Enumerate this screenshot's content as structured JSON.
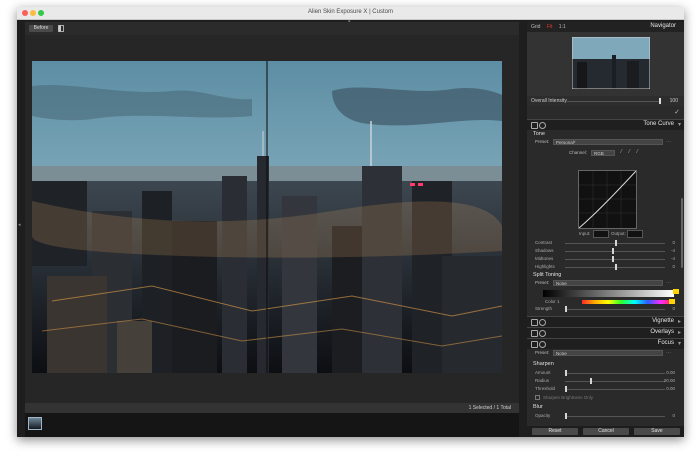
{
  "window": {
    "title": "Alien Skin Exposure X | Custom"
  },
  "viewer": {
    "before_label": "Before",
    "info_bar": "1 Selected / 1 Total"
  },
  "navigator": {
    "tabs": [
      "Grid",
      "Fit",
      "1:1"
    ],
    "title": "Navigator",
    "overall_intensity_label": "Overall Intensity",
    "overall_intensity_value": "100"
  },
  "tone_curve": {
    "title": "Tone Curve",
    "tone_label": "Tone",
    "preset_label": "Preset:",
    "preset_value": "Personal*",
    "channel_label": "Channel:",
    "channel_value": "RGB",
    "input_label": "Input:",
    "output_label": "Output:",
    "sliders": [
      {
        "label": "Contrast",
        "value": "0",
        "pos": 0.5
      },
      {
        "label": "Shadows",
        "value": "-4",
        "pos": 0.47
      },
      {
        "label": "Midtones",
        "value": "-4",
        "pos": 0.47
      },
      {
        "label": "Highlights",
        "value": "0",
        "pos": 0.5
      }
    ]
  },
  "split_toning": {
    "title": "Split Toning",
    "preset_label": "Preset:",
    "preset_value": "None",
    "color1_label": "Color 1",
    "strength_label": "Strength",
    "strength_value": "0",
    "color1_swatch": "#ffd400"
  },
  "vignette": {
    "title": "Vignette"
  },
  "overlays": {
    "title": "Overlays"
  },
  "focus": {
    "title": "Focus",
    "preset_label": "Preset:",
    "preset_value": "None",
    "sharpen_label": "Sharpen",
    "sharpen_sliders": [
      {
        "label": "Amount",
        "value": "0.00",
        "pos": 0.0
      },
      {
        "label": "Radius",
        "value": "20.00",
        "pos": 0.25
      },
      {
        "label": "Threshold",
        "value": "0.00",
        "pos": 0.0
      }
    ],
    "sharpen_brightness_label": "Sharpen Brightness Only",
    "blur_label": "Blur",
    "opacity_label": "Opacity",
    "opacity_value": "0"
  },
  "footer": {
    "reset_label": "Reset",
    "cancel_label": "Cancel",
    "save_label": "Save"
  },
  "colors": {
    "accent_red": "#e2372d",
    "panel_bg": "#2a2a2a",
    "viewer_bg": "#262626"
  }
}
